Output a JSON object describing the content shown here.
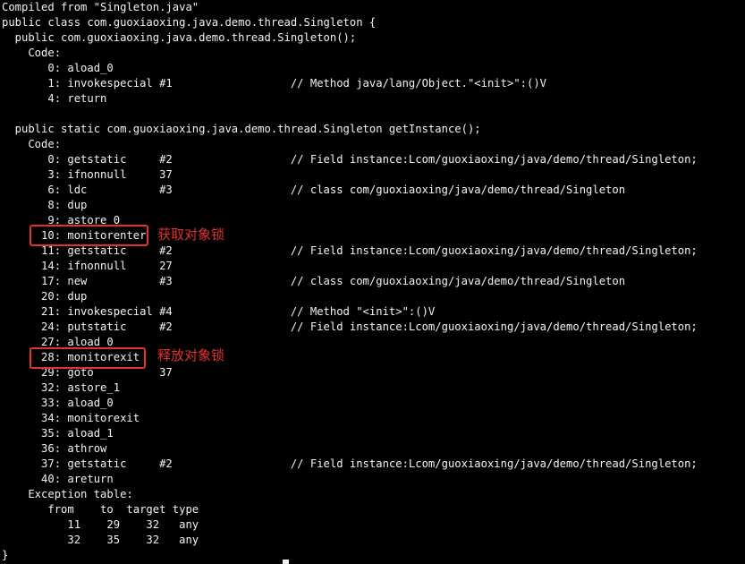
{
  "lines": [
    "Compiled from \"Singleton.java\"",
    "public class com.guoxiaoxing.java.demo.thread.Singleton {",
    "  public com.guoxiaoxing.java.demo.thread.Singleton();",
    "    Code:",
    "       0: aload_0",
    "       1: invokespecial #1                  // Method java/lang/Object.\"<init>\":()V",
    "       4: return",
    "",
    "  public static com.guoxiaoxing.java.demo.thread.Singleton getInstance();",
    "    Code:",
    "       0: getstatic     #2                  // Field instance:Lcom/guoxiaoxing/java/demo/thread/Singleton;",
    "       3: ifnonnull     37",
    "       6: ldc           #3                  // class com/guoxiaoxing/java/demo/thread/Singleton",
    "       8: dup",
    "       9: astore_0",
    "      10: monitorenter",
    "      11: getstatic     #2                  // Field instance:Lcom/guoxiaoxing/java/demo/thread/Singleton;",
    "      14: ifnonnull     27",
    "      17: new           #3                  // class com/guoxiaoxing/java/demo/thread/Singleton",
    "      20: dup",
    "      21: invokespecial #4                  // Method \"<init>\":()V",
    "      24: putstatic     #2                  // Field instance:Lcom/guoxiaoxing/java/demo/thread/Singleton;",
    "      27: aload_0",
    "      28: monitorexit",
    "      29: goto          37",
    "      32: astore_1",
    "      33: aload_0",
    "      34: monitorexit",
    "      35: aload_1",
    "      36: athrow",
    "      37: getstatic     #2                  // Field instance:Lcom/guoxiaoxing/java/demo/thread/Singleton;",
    "      40: areturn",
    "    Exception table:",
    "       from    to  target type",
    "          11    29    32   any",
    "          32    35    32   any",
    "}"
  ],
  "annotations": {
    "monitorenter_label": "获取对象锁",
    "monitorexit_label": "释放对象锁"
  },
  "colors": {
    "background": "#000000",
    "text": "#f2f2f2",
    "annotation": "#e53030"
  }
}
